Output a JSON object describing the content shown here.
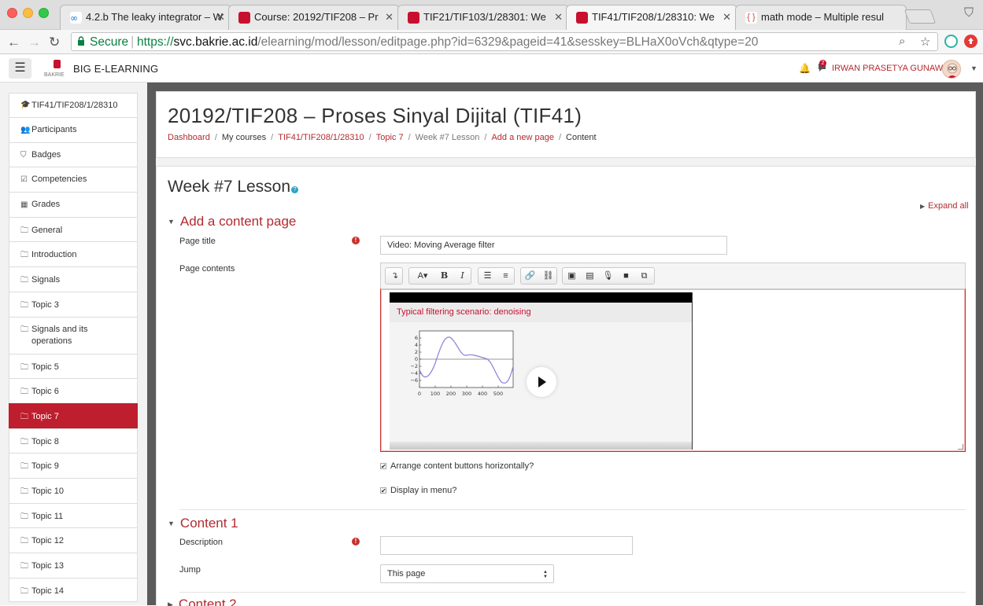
{
  "browser": {
    "tabs": [
      {
        "title": "4.2.b The leaky integrator – W",
        "icon_color": "#1a73e8",
        "active": false
      },
      {
        "title": "Course: 20192/TIF208 – Pr",
        "icon_color": "#c8102e",
        "active": false
      },
      {
        "title": "TIF21/TIF103/1/28301: We",
        "icon_color": "#c8102e",
        "active": false
      },
      {
        "title": "TIF41/TIF208/1/28310: We",
        "icon_color": "#c8102e",
        "active": true
      },
      {
        "title": "math mode – Multiple resul",
        "icon_color": "#d04a3a",
        "active": false
      }
    ],
    "secure_label": "Secure",
    "url_scheme": "https://",
    "url_host": "svc.bakrie.ac.id",
    "url_rest": "/elearning/mod/lesson/editpage.php?id=6329&pageid=41&sesskey=BLHaX0oVch&qtype=20"
  },
  "navbar": {
    "brand_logo_text": "BAKRIE",
    "brand_name": "BIG E-LEARNING",
    "message_count": "2",
    "user_name": "IRWAN PRASETYA GUNAWAN"
  },
  "sidebar": {
    "items": [
      {
        "icon": "graduation-cap-icon",
        "glyph": "🎓",
        "label": "TIF41/TIF208/1/28310"
      },
      {
        "icon": "users-icon",
        "glyph": "👥",
        "label": "Participants"
      },
      {
        "icon": "shield-icon",
        "glyph": "⛉",
        "label": "Badges"
      },
      {
        "icon": "checkbox-icon",
        "glyph": "☑",
        "label": "Competencies"
      },
      {
        "icon": "table-icon",
        "glyph": "▦",
        "label": "Grades"
      },
      {
        "icon": "folder-icon",
        "glyph": "🗀",
        "label": "General"
      },
      {
        "icon": "folder-icon",
        "glyph": "🗀",
        "label": "Introduction"
      },
      {
        "icon": "folder-icon",
        "glyph": "🗀",
        "label": "Signals"
      },
      {
        "icon": "folder-icon",
        "glyph": "🗀",
        "label": "Topic 3"
      },
      {
        "icon": "folder-icon",
        "glyph": "🗀",
        "label": "Signals and its operations"
      },
      {
        "icon": "folder-icon",
        "glyph": "🗀",
        "label": "Topic 5"
      },
      {
        "icon": "folder-icon",
        "glyph": "🗀",
        "label": "Topic 6"
      },
      {
        "icon": "folder-icon",
        "glyph": "🗀",
        "label": "Topic 7"
      },
      {
        "icon": "folder-icon",
        "glyph": "🗀",
        "label": "Topic 8"
      },
      {
        "icon": "folder-icon",
        "glyph": "🗀",
        "label": "Topic 9"
      },
      {
        "icon": "folder-icon",
        "glyph": "🗀",
        "label": "Topic 10"
      },
      {
        "icon": "folder-icon",
        "glyph": "🗀",
        "label": "Topic 11"
      },
      {
        "icon": "folder-icon",
        "glyph": "🗀",
        "label": "Topic 12"
      },
      {
        "icon": "folder-icon",
        "glyph": "🗀",
        "label": "Topic 13"
      },
      {
        "icon": "folder-icon",
        "glyph": "🗀",
        "label": "Topic 14"
      }
    ],
    "active_label": "Topic 7"
  },
  "header": {
    "course_title": "20192/TIF208 – Proses Sinyal Dijital (TIF41)",
    "breadcrumb": [
      {
        "label": "Dashboard",
        "link": true
      },
      {
        "label": "My courses",
        "link": false
      },
      {
        "label": "TIF41/TIF208/1/28310",
        "link": true
      },
      {
        "label": "Topic 7",
        "link": true
      },
      {
        "label": "Week #7 Lesson",
        "link": false
      },
      {
        "label": "Add a new page",
        "link": true
      },
      {
        "label": "Content",
        "link": false
      }
    ]
  },
  "main": {
    "lesson_title": "Week #7 Lesson",
    "expand_all": "Expand all",
    "section_add": "Add a content page",
    "page_title_label": "Page title",
    "page_title_value": "Video: Moving Average filter",
    "page_contents_label": "Page contents",
    "video_caption": "Typical filtering scenario:  denoising",
    "plot_y_ticks": [
      "6",
      "4",
      "2",
      "0",
      "−2",
      "−4",
      "−6"
    ],
    "plot_x_ticks": [
      "0",
      "100",
      "200",
      "300",
      "400",
      "500"
    ],
    "arrange_label": "Arrange content buttons horizontally?",
    "display_menu_label": "Display in menu?",
    "section_content1": "Content 1",
    "description_label": "Description",
    "description_value": "",
    "jump_label": "Jump",
    "jump_value": "This page",
    "section_content2": "Content 2"
  }
}
